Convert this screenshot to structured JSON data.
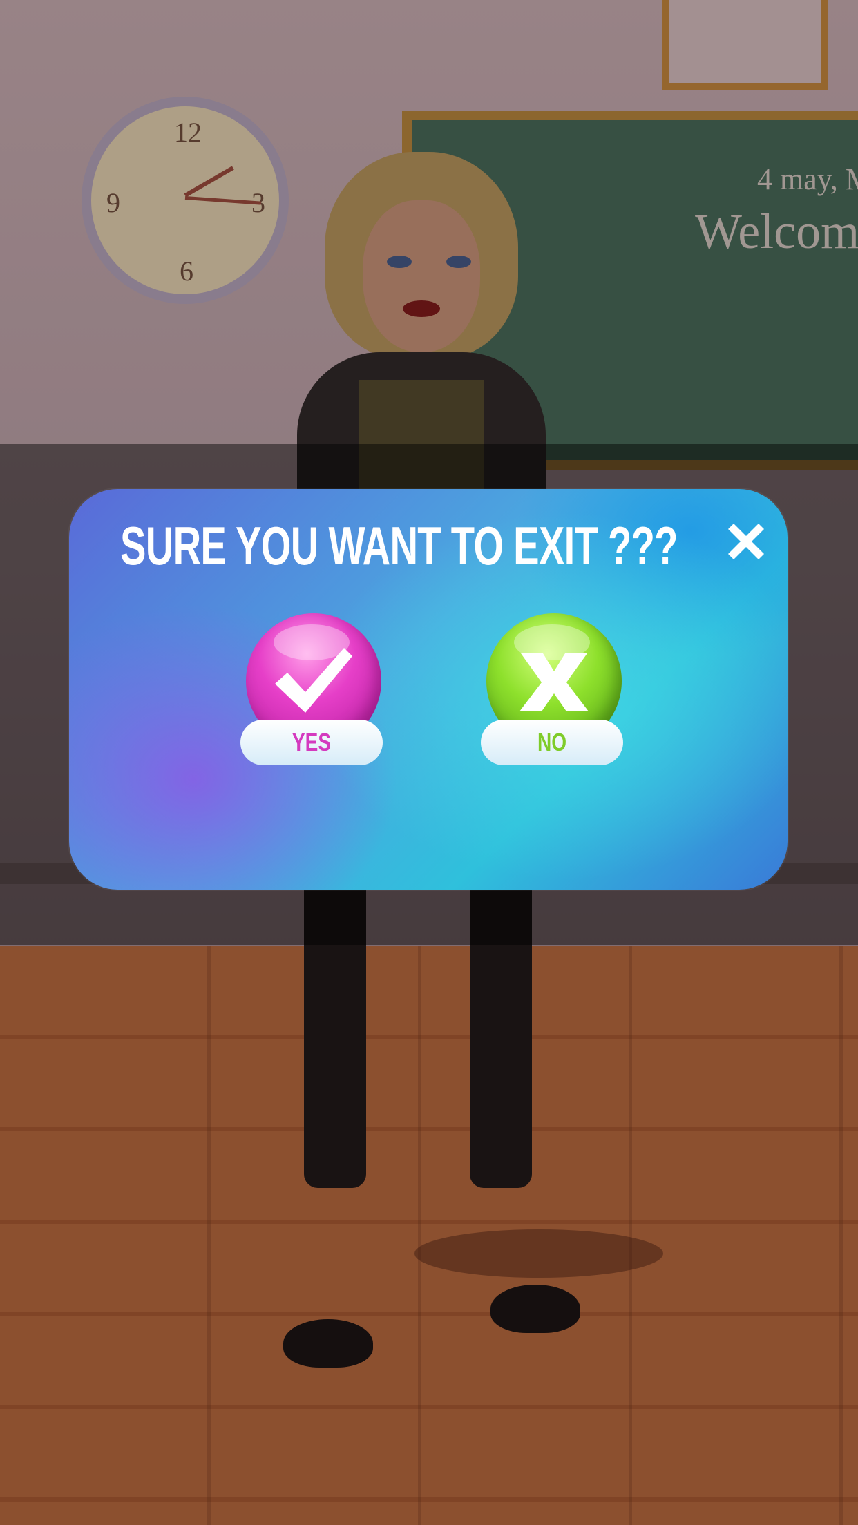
{
  "dialog": {
    "title": "SURE YOU WANT TO EXIT ???",
    "close_icon": "close-icon",
    "yes": {
      "label": "YES",
      "icon": "checkmark-icon",
      "color": "#e63fc8"
    },
    "no": {
      "label": "NO",
      "icon": "x-mark-icon",
      "color": "#8ee02c"
    }
  },
  "background": {
    "clock_numbers": [
      "12",
      "3",
      "6",
      "9"
    ],
    "board_date": "4 may, M",
    "board_heading": "Welcome"
  }
}
